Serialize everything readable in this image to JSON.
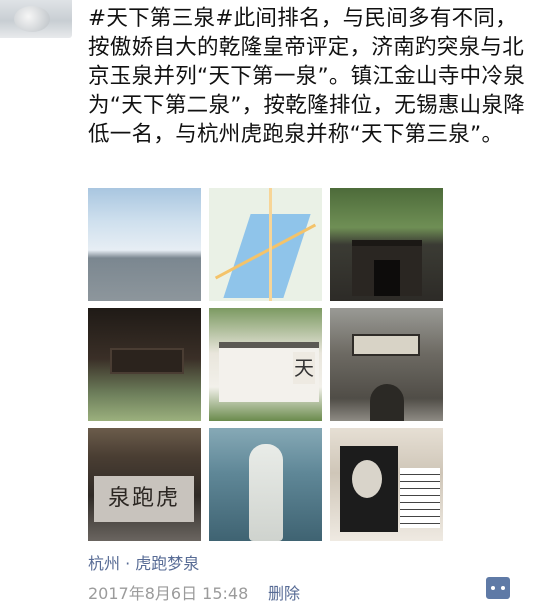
{
  "post": {
    "text": "#天下第三泉#此间排名，与民间多有不同，按傲娇自大的乾隆皇帝评定，济南趵突泉与北京玉泉并列“天下第一泉”。镇江金山寺中冷泉为“天下第二泉”，按乾隆排位，无锡惠山泉降低一名，与杭州虎跑泉并称“天下第三泉”。"
  },
  "photos": {
    "tile5_char": "天",
    "tile7_inscription": "泉跑虎"
  },
  "location": "杭州 · 虎跑梦泉",
  "footer": {
    "time": "2017年8月6日 15:48",
    "delete_label": "删除"
  },
  "icons": {
    "more": "comment-more-icon"
  },
  "colors": {
    "link": "#576b95",
    "meta": "#9b9b9b"
  }
}
